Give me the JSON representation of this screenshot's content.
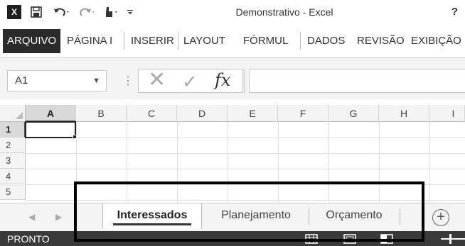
{
  "titlebar": {
    "app_icon": "excel-icon",
    "app_icon_text": "X",
    "title": "Demonstrativo - Excel",
    "help": "?"
  },
  "ribbon": {
    "tabs": [
      {
        "label": "ARQUIVO"
      },
      {
        "label": "PÁGINA I"
      },
      {
        "label": "INSERIR"
      },
      {
        "label": "LAYOUT"
      },
      {
        "label": "FÓRMUL"
      },
      {
        "label": "DADOS"
      },
      {
        "label": "REVISÃO"
      },
      {
        "label": "EXIBIÇÃO"
      }
    ]
  },
  "formula_bar": {
    "name_box": "A1",
    "cancel_symbol": "✕",
    "enter_symbol": "✓",
    "function_symbol": "fx",
    "value": ""
  },
  "grid": {
    "columns": [
      "A",
      "B",
      "C",
      "D",
      "E",
      "F",
      "G",
      "H",
      "I"
    ],
    "rows": [
      "1",
      "2",
      "3",
      "4",
      "5"
    ],
    "selected_cell": "A1"
  },
  "sheets": {
    "tabs": [
      {
        "label": "Interessados"
      },
      {
        "label": "Planejamento"
      },
      {
        "label": "Orçamento"
      }
    ],
    "active": "Interessados",
    "add_symbol": "+"
  },
  "status": {
    "text": "PRONTO"
  }
}
